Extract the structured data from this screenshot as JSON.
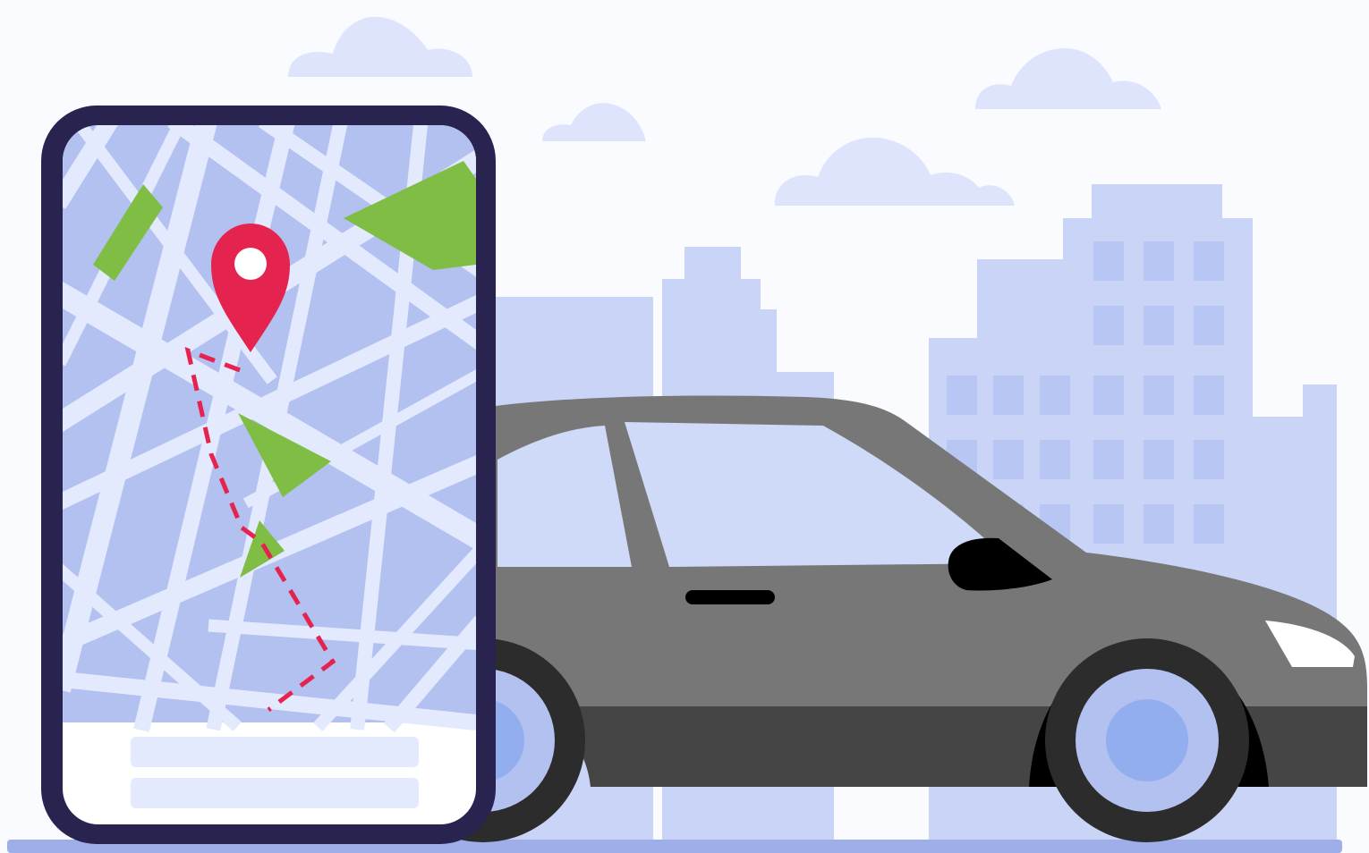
{
  "colors": {
    "background": "#fafbfe",
    "cloud": "#dde4fb",
    "building_light": "#c9d4f7",
    "building_window": "#b8c6f3",
    "ground": "#9daee9",
    "phone_frame": "#29234f",
    "phone_screen": "#ffffff",
    "map_block": "#b3c1f0",
    "map_road": "#e4eafd",
    "park": "#80bd45",
    "pin": "#e5234f",
    "route": "#e5234f",
    "car_body": "#777777",
    "car_lower": "#454545",
    "tire": "#2c2c2c",
    "hubcap": "#b3c1f0",
    "hubcap_center": "#93aeee",
    "glass": "#cfd9f8",
    "headlight": "#ffffff",
    "mirror": "#000000"
  },
  "icons": [
    "location-pin-icon",
    "route-dashed-line",
    "direction-arrow-icon"
  ],
  "phone": {
    "bottom_bars": 2
  }
}
